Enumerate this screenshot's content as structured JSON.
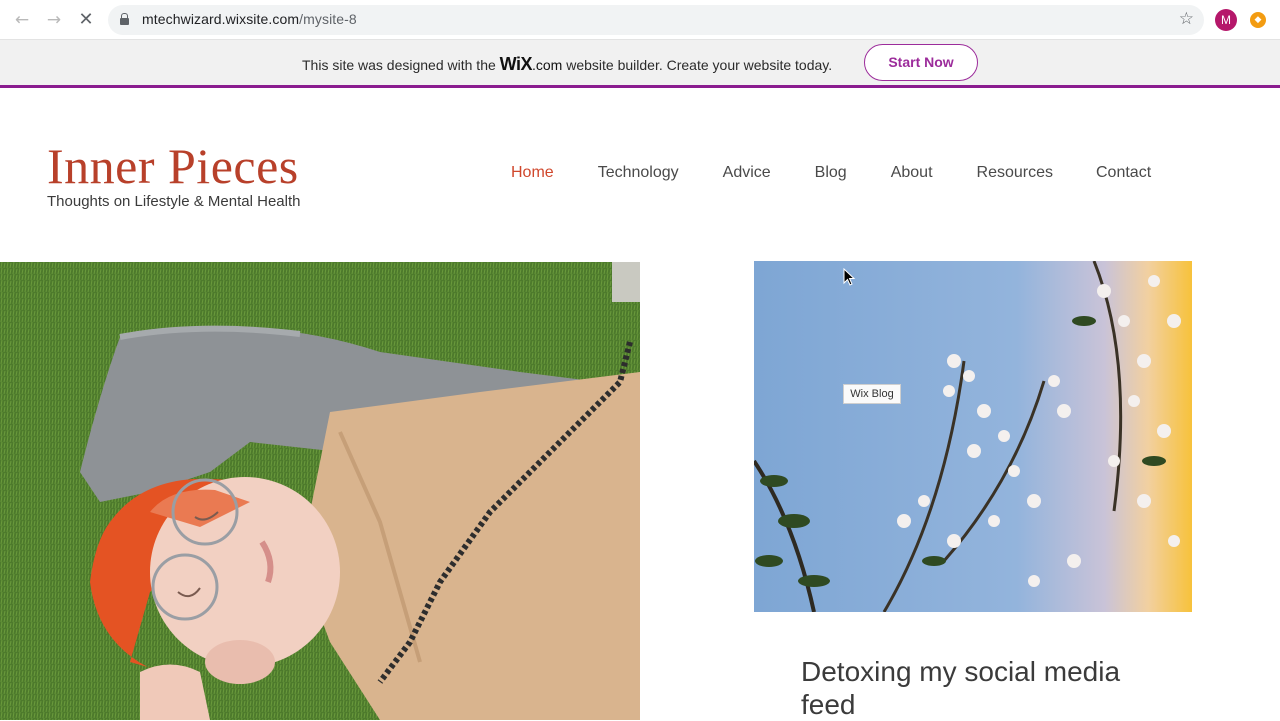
{
  "browser": {
    "url_host": "mtechwizard.wixsite.com",
    "url_path": "/mysite-8",
    "profile_initial": "M"
  },
  "banner": {
    "text_before": "This site was designed with the ",
    "wix_logo": "WiX",
    "wix_suffix": ".com",
    "text_after": " website builder. Create your website today.",
    "cta_label": "Start Now",
    "accent_color": "#9c2c9b"
  },
  "site": {
    "title": "Inner Pieces",
    "tagline": "Thoughts on Lifestyle & Mental Health",
    "title_color": "#b8402a"
  },
  "nav": {
    "items": [
      {
        "label": "Home",
        "active": true
      },
      {
        "label": "Technology",
        "active": false
      },
      {
        "label": "Advice",
        "active": false
      },
      {
        "label": "Blog",
        "active": false
      },
      {
        "label": "About",
        "active": false
      },
      {
        "label": "Resources",
        "active": false
      },
      {
        "label": "Contact",
        "active": false
      }
    ]
  },
  "content": {
    "image_tag": "Wix Blog",
    "post_title": "Detoxing my social media feed"
  },
  "icons": [
    "back-arrow-icon",
    "forward-arrow-icon",
    "stop-loading-icon",
    "lock-icon",
    "star-icon",
    "extension-icon",
    "mouse-cursor-icon"
  ]
}
